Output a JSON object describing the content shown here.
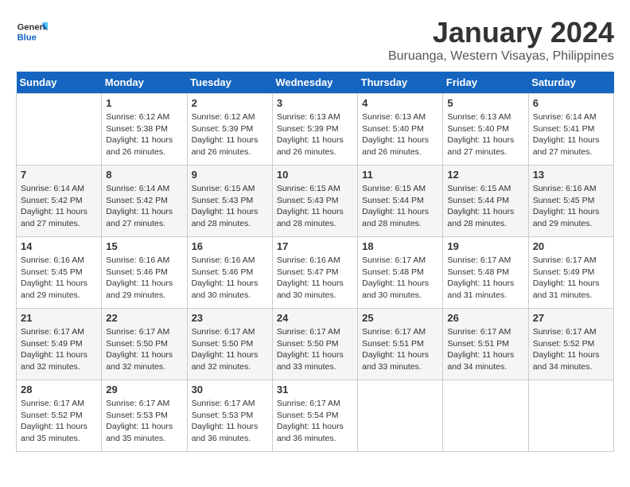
{
  "header": {
    "logo_line1": "General",
    "logo_line2": "Blue",
    "month_title": "January 2024",
    "subtitle": "Buruanga, Western Visayas, Philippines"
  },
  "days_of_week": [
    "Sunday",
    "Monday",
    "Tuesday",
    "Wednesday",
    "Thursday",
    "Friday",
    "Saturday"
  ],
  "weeks": [
    [
      {
        "day": "",
        "info": ""
      },
      {
        "day": "1",
        "info": "Sunrise: 6:12 AM\nSunset: 5:38 PM\nDaylight: 11 hours\nand 26 minutes."
      },
      {
        "day": "2",
        "info": "Sunrise: 6:12 AM\nSunset: 5:39 PM\nDaylight: 11 hours\nand 26 minutes."
      },
      {
        "day": "3",
        "info": "Sunrise: 6:13 AM\nSunset: 5:39 PM\nDaylight: 11 hours\nand 26 minutes."
      },
      {
        "day": "4",
        "info": "Sunrise: 6:13 AM\nSunset: 5:40 PM\nDaylight: 11 hours\nand 26 minutes."
      },
      {
        "day": "5",
        "info": "Sunrise: 6:13 AM\nSunset: 5:40 PM\nDaylight: 11 hours\nand 27 minutes."
      },
      {
        "day": "6",
        "info": "Sunrise: 6:14 AM\nSunset: 5:41 PM\nDaylight: 11 hours\nand 27 minutes."
      }
    ],
    [
      {
        "day": "7",
        "info": "Sunrise: 6:14 AM\nSunset: 5:42 PM\nDaylight: 11 hours\nand 27 minutes."
      },
      {
        "day": "8",
        "info": "Sunrise: 6:14 AM\nSunset: 5:42 PM\nDaylight: 11 hours\nand 27 minutes."
      },
      {
        "day": "9",
        "info": "Sunrise: 6:15 AM\nSunset: 5:43 PM\nDaylight: 11 hours\nand 28 minutes."
      },
      {
        "day": "10",
        "info": "Sunrise: 6:15 AM\nSunset: 5:43 PM\nDaylight: 11 hours\nand 28 minutes."
      },
      {
        "day": "11",
        "info": "Sunrise: 6:15 AM\nSunset: 5:44 PM\nDaylight: 11 hours\nand 28 minutes."
      },
      {
        "day": "12",
        "info": "Sunrise: 6:15 AM\nSunset: 5:44 PM\nDaylight: 11 hours\nand 28 minutes."
      },
      {
        "day": "13",
        "info": "Sunrise: 6:16 AM\nSunset: 5:45 PM\nDaylight: 11 hours\nand 29 minutes."
      }
    ],
    [
      {
        "day": "14",
        "info": "Sunrise: 6:16 AM\nSunset: 5:45 PM\nDaylight: 11 hours\nand 29 minutes."
      },
      {
        "day": "15",
        "info": "Sunrise: 6:16 AM\nSunset: 5:46 PM\nDaylight: 11 hours\nand 29 minutes."
      },
      {
        "day": "16",
        "info": "Sunrise: 6:16 AM\nSunset: 5:46 PM\nDaylight: 11 hours\nand 30 minutes."
      },
      {
        "day": "17",
        "info": "Sunrise: 6:16 AM\nSunset: 5:47 PM\nDaylight: 11 hours\nand 30 minutes."
      },
      {
        "day": "18",
        "info": "Sunrise: 6:17 AM\nSunset: 5:48 PM\nDaylight: 11 hours\nand 30 minutes."
      },
      {
        "day": "19",
        "info": "Sunrise: 6:17 AM\nSunset: 5:48 PM\nDaylight: 11 hours\nand 31 minutes."
      },
      {
        "day": "20",
        "info": "Sunrise: 6:17 AM\nSunset: 5:49 PM\nDaylight: 11 hours\nand 31 minutes."
      }
    ],
    [
      {
        "day": "21",
        "info": "Sunrise: 6:17 AM\nSunset: 5:49 PM\nDaylight: 11 hours\nand 32 minutes."
      },
      {
        "day": "22",
        "info": "Sunrise: 6:17 AM\nSunset: 5:50 PM\nDaylight: 11 hours\nand 32 minutes."
      },
      {
        "day": "23",
        "info": "Sunrise: 6:17 AM\nSunset: 5:50 PM\nDaylight: 11 hours\nand 32 minutes."
      },
      {
        "day": "24",
        "info": "Sunrise: 6:17 AM\nSunset: 5:50 PM\nDaylight: 11 hours\nand 33 minutes."
      },
      {
        "day": "25",
        "info": "Sunrise: 6:17 AM\nSunset: 5:51 PM\nDaylight: 11 hours\nand 33 minutes."
      },
      {
        "day": "26",
        "info": "Sunrise: 6:17 AM\nSunset: 5:51 PM\nDaylight: 11 hours\nand 34 minutes."
      },
      {
        "day": "27",
        "info": "Sunrise: 6:17 AM\nSunset: 5:52 PM\nDaylight: 11 hours\nand 34 minutes."
      }
    ],
    [
      {
        "day": "28",
        "info": "Sunrise: 6:17 AM\nSunset: 5:52 PM\nDaylight: 11 hours\nand 35 minutes."
      },
      {
        "day": "29",
        "info": "Sunrise: 6:17 AM\nSunset: 5:53 PM\nDaylight: 11 hours\nand 35 minutes."
      },
      {
        "day": "30",
        "info": "Sunrise: 6:17 AM\nSunset: 5:53 PM\nDaylight: 11 hours\nand 36 minutes."
      },
      {
        "day": "31",
        "info": "Sunrise: 6:17 AM\nSunset: 5:54 PM\nDaylight: 11 hours\nand 36 minutes."
      },
      {
        "day": "",
        "info": ""
      },
      {
        "day": "",
        "info": ""
      },
      {
        "day": "",
        "info": ""
      }
    ]
  ]
}
